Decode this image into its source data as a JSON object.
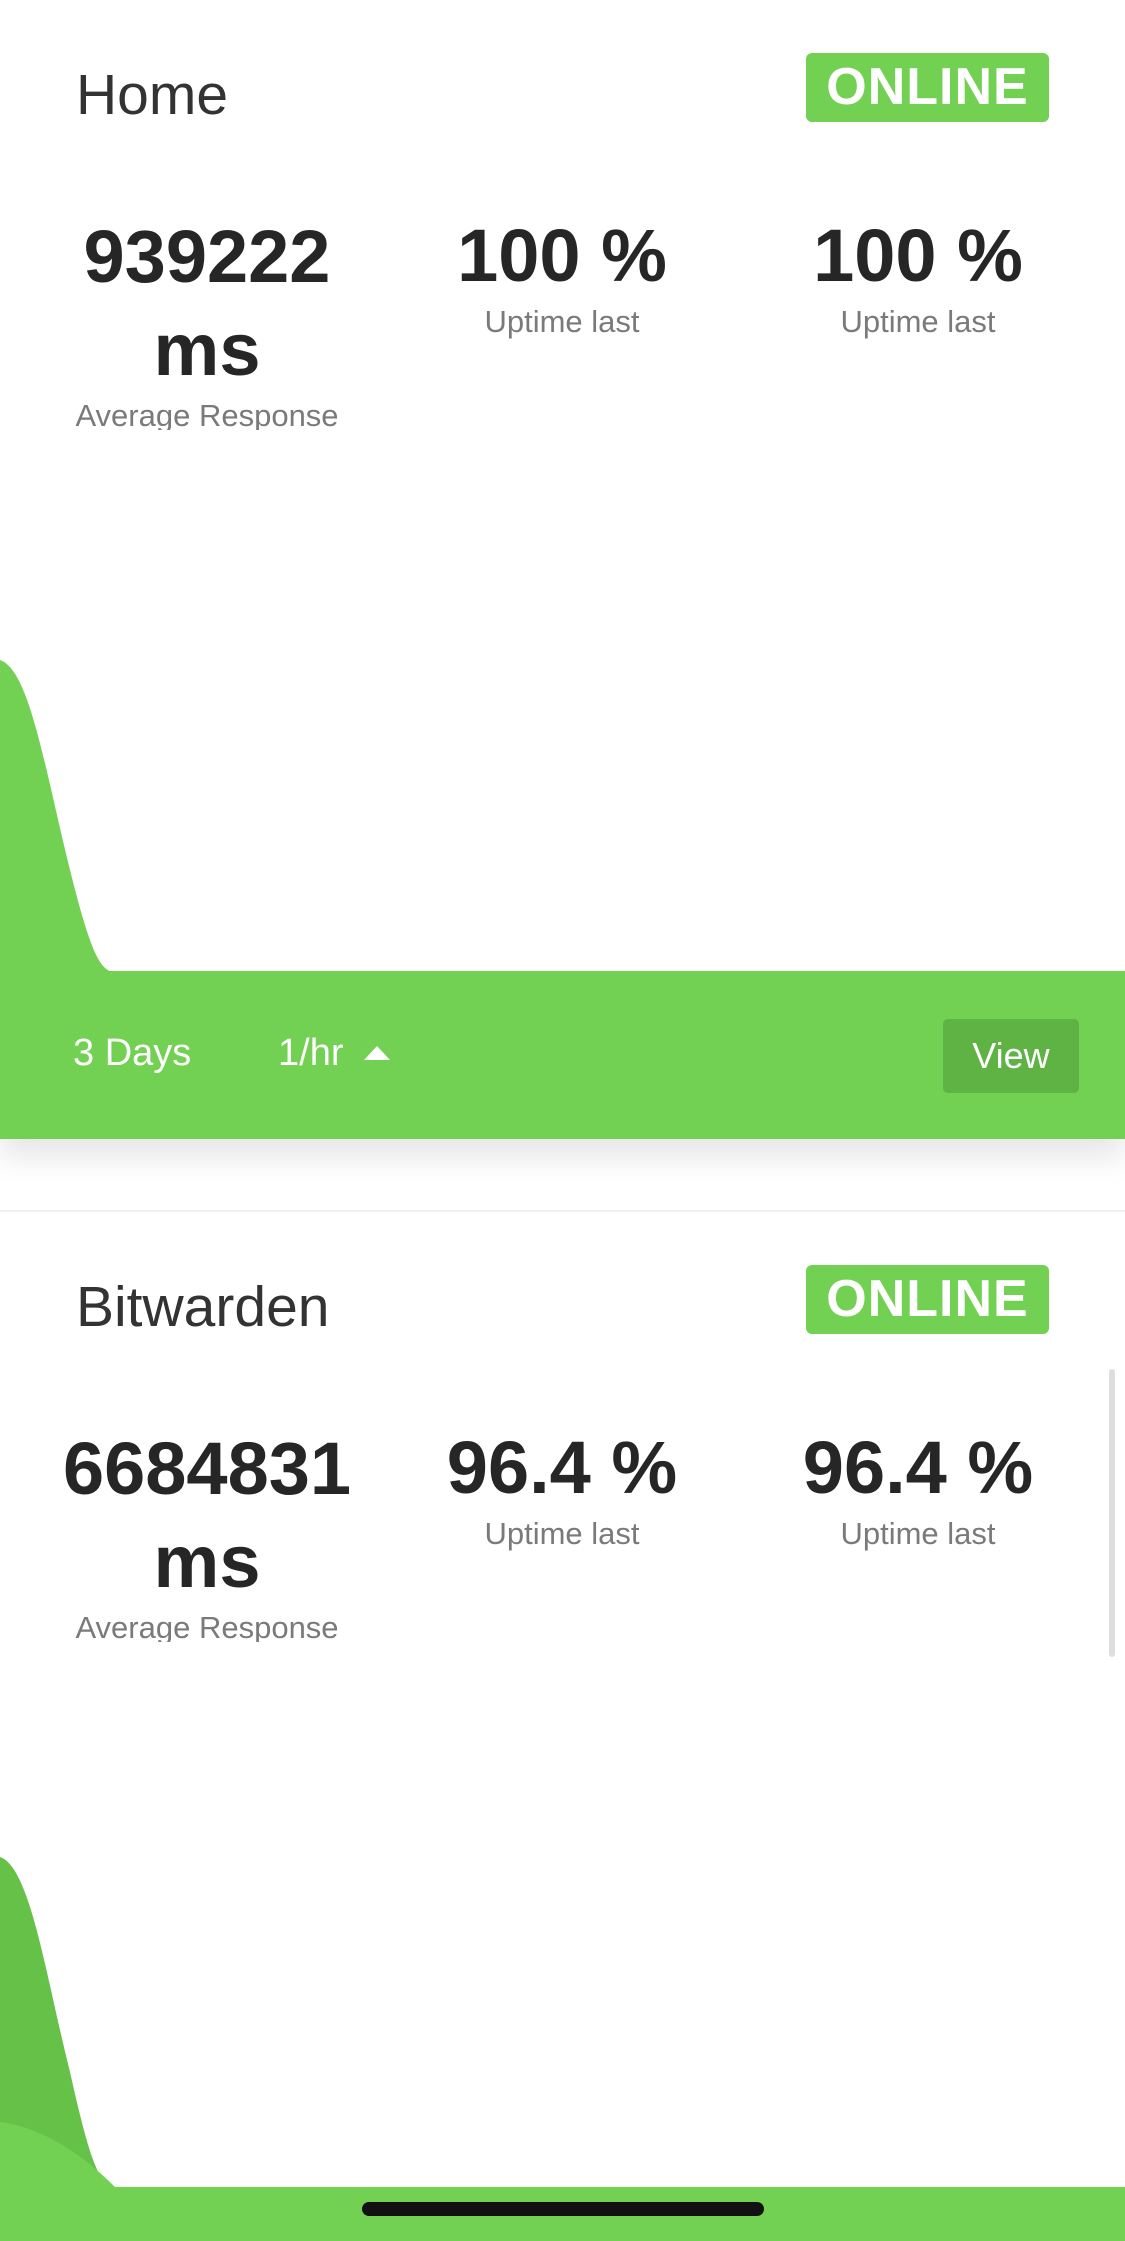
{
  "monitors": [
    {
      "name": "Home",
      "status": "ONLINE",
      "avg_response_value": "939222",
      "avg_response_unit": "ms",
      "avg_response_label": "Average Response",
      "uptime_1_value": "100 %",
      "uptime_1_label": "Uptime last",
      "uptime_2_value": "100 %",
      "uptime_2_label": "Uptime last",
      "range_label": "3 Days",
      "interval_label": "1/hr",
      "view_label": "View"
    },
    {
      "name": "Bitwarden",
      "status": "ONLINE",
      "avg_response_value": "6684831",
      "avg_response_unit": "ms",
      "avg_response_label": "Average Response",
      "uptime_1_value": "96.4 %",
      "uptime_1_label": "Uptime last",
      "uptime_2_value": "96.4 %",
      "uptime_2_label": "Uptime last"
    }
  ],
  "colors": {
    "accent": "#72d152",
    "button": "#5fb244",
    "chart_dark": "#66c148"
  },
  "icons": {
    "interval_dropdown": "caret-up-icon"
  }
}
